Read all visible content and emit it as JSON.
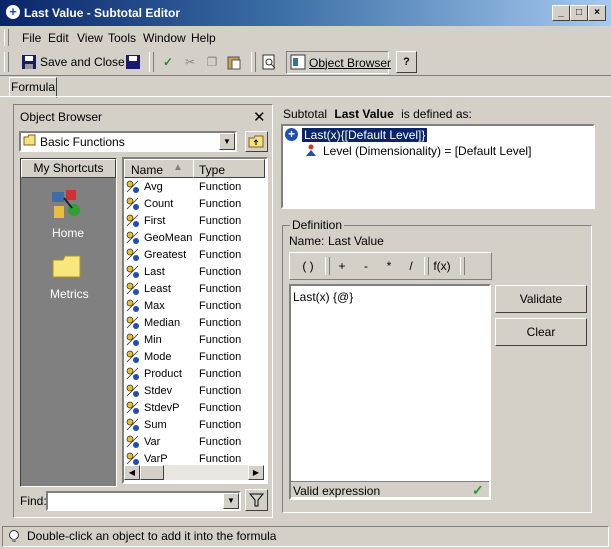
{
  "window": {
    "title": "Last Value - Subtotal Editor"
  },
  "menu": [
    "File",
    "Edit",
    "View",
    "Tools",
    "Window",
    "Help"
  ],
  "toolbar": {
    "save_close": "Save and Close",
    "object_browser": "Object Browser"
  },
  "tabs": {
    "formula": "Formula"
  },
  "object_browser": {
    "title": "Object Browser",
    "folder": "Basic Functions",
    "shortcuts_title": "My Shortcuts",
    "shortcuts": [
      "Home",
      "Metrics"
    ],
    "columns": {
      "name": "Name",
      "type": "Type"
    },
    "functions": [
      {
        "name": "Avg",
        "type": "Function"
      },
      {
        "name": "Count",
        "type": "Function"
      },
      {
        "name": "First",
        "type": "Function"
      },
      {
        "name": "GeoMean",
        "type": "Function"
      },
      {
        "name": "Greatest",
        "type": "Function"
      },
      {
        "name": "Last",
        "type": "Function"
      },
      {
        "name": "Least",
        "type": "Function"
      },
      {
        "name": "Max",
        "type": "Function"
      },
      {
        "name": "Median",
        "type": "Function"
      },
      {
        "name": "Min",
        "type": "Function"
      },
      {
        "name": "Mode",
        "type": "Function"
      },
      {
        "name": "Product",
        "type": "Function"
      },
      {
        "name": "Stdev",
        "type": "Function"
      },
      {
        "name": "StdevP",
        "type": "Function"
      },
      {
        "name": "Sum",
        "type": "Function"
      },
      {
        "name": "Var",
        "type": "Function"
      },
      {
        "name": "VarP",
        "type": "Function"
      }
    ],
    "find_label": "Find:",
    "find_value": ""
  },
  "subtotal": {
    "prefix": "Subtotal",
    "name": "Last Value",
    "suffix": "is defined as:",
    "tree_root": "Last(x){[Default Level]}",
    "tree_child": "Level (Dimensionality) = [Default Level]"
  },
  "definition": {
    "group_label": "Definition",
    "name_label": "Name:",
    "name_value": "Last Value",
    "operators": [
      "( )",
      "+",
      "-",
      "*",
      "/",
      "f(x)"
    ],
    "formula": "Last(x) {@}",
    "status": "Valid expression",
    "validate_label": "Validate",
    "clear_label": "Clear"
  },
  "statusbar": {
    "text": "Double-click an object to add it into the formula"
  }
}
